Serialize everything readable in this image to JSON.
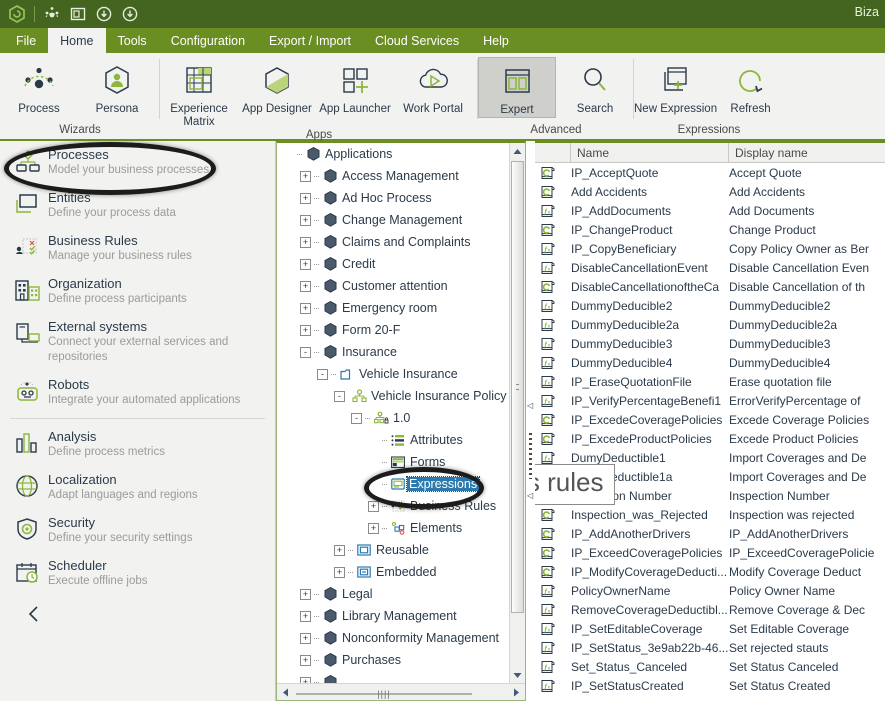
{
  "titlebar": {
    "app_title": "Biza",
    "quick_icons": [
      "logo-icon",
      "process-icon",
      "window-icon",
      "download-icon",
      "upload-icon"
    ]
  },
  "menubar": {
    "items": [
      {
        "label": "File",
        "active": false
      },
      {
        "label": "Home",
        "active": true
      },
      {
        "label": "Tools",
        "active": false
      },
      {
        "label": "Configuration",
        "active": false
      },
      {
        "label": "Export / Import",
        "active": false
      },
      {
        "label": "Cloud Services",
        "active": false
      },
      {
        "label": "Help",
        "active": false
      }
    ]
  },
  "ribbon": {
    "groups": [
      {
        "name": "Wizards",
        "buttons": [
          {
            "label": "Process",
            "icon": "process-network-icon",
            "selected": false
          },
          {
            "label": "Persona",
            "icon": "persona-icon",
            "selected": false
          }
        ]
      },
      {
        "name": "Apps",
        "buttons": [
          {
            "label": "Experience Matrix",
            "icon": "experience-matrix-icon",
            "selected": false
          },
          {
            "label": "App Designer",
            "icon": "app-designer-icon",
            "selected": false
          },
          {
            "label": "App Launcher",
            "icon": "app-launcher-icon",
            "selected": false
          },
          {
            "label": "Work Portal",
            "icon": "work-portal-icon",
            "selected": false
          }
        ]
      },
      {
        "name": "Advanced",
        "buttons": [
          {
            "label": "Expert",
            "icon": "expert-icon",
            "selected": true
          },
          {
            "label": "Search",
            "icon": "search-icon",
            "selected": false
          }
        ]
      },
      {
        "name": "Expressions",
        "buttons": [
          {
            "label": "New Expression",
            "icon": "new-expression-icon",
            "selected": false
          },
          {
            "label": "Refresh",
            "icon": "refresh-icon",
            "selected": false
          }
        ]
      }
    ]
  },
  "sidebar": {
    "items": [
      {
        "title": "Processes",
        "subtitle": "Model your business processes",
        "icon": "processes-icon",
        "highlighted": true
      },
      {
        "title": "Entities",
        "subtitle": "Define your process data",
        "icon": "entities-icon",
        "highlighted": false
      },
      {
        "title": "Business  Rules",
        "subtitle": "Manage your business rules",
        "icon": "rules-icon",
        "highlighted": false
      },
      {
        "title": "Organization",
        "subtitle": "Define process participants",
        "icon": "org-icon",
        "highlighted": false
      },
      {
        "title": "External systems",
        "subtitle": "Connect your external services and repositories",
        "icon": "external-icon",
        "highlighted": false
      },
      {
        "title": "Robots",
        "subtitle": "Integrate your automated applications",
        "icon": "robot-icon",
        "highlighted": false
      }
    ],
    "items2": [
      {
        "title": "Analysis",
        "subtitle": "Define process metrics",
        "icon": "analysis-icon"
      },
      {
        "title": "Localization",
        "subtitle": "Adapt languages and regions",
        "icon": "globe-icon"
      },
      {
        "title": "Security",
        "subtitle": "Define your security settings",
        "icon": "shield-icon"
      },
      {
        "title": "Scheduler",
        "subtitle": "Execute offline jobs",
        "icon": "calendar-clock-icon"
      }
    ],
    "collapse_icon": "chevron-left-icon"
  },
  "tree": {
    "nodes": [
      {
        "label": "Applications",
        "depth": 0,
        "expander": "",
        "icon": "app-hex-icon",
        "selected": false
      },
      {
        "label": "Access Management",
        "depth": 1,
        "expander": "+",
        "icon": "app-hex-icon",
        "selected": false
      },
      {
        "label": "Ad Hoc Process",
        "depth": 1,
        "expander": "+",
        "icon": "app-hex-icon",
        "selected": false
      },
      {
        "label": "Change Management",
        "depth": 1,
        "expander": "+",
        "icon": "app-hex-icon",
        "selected": false
      },
      {
        "label": "Claims and Complaints",
        "depth": 1,
        "expander": "+",
        "icon": "app-hex-icon",
        "selected": false
      },
      {
        "label": "Credit",
        "depth": 1,
        "expander": "+",
        "icon": "app-hex-icon",
        "selected": false
      },
      {
        "label": "Customer attention",
        "depth": 1,
        "expander": "+",
        "icon": "app-hex-icon",
        "selected": false
      },
      {
        "label": "Emergency room",
        "depth": 1,
        "expander": "+",
        "icon": "app-hex-icon",
        "selected": false
      },
      {
        "label": "Form 20-F",
        "depth": 1,
        "expander": "+",
        "icon": "app-hex-icon",
        "selected": false
      },
      {
        "label": "Insurance",
        "depth": 1,
        "expander": "-",
        "icon": "app-hex-icon",
        "selected": false
      },
      {
        "label": "Vehicle Insurance",
        "depth": 2,
        "expander": "-",
        "icon": "folder-icon",
        "selected": false
      },
      {
        "label": "Vehicle Insurance Policy Underwri",
        "depth": 3,
        "expander": "-",
        "icon": "process-tree-icon",
        "selected": false
      },
      {
        "label": "1.0",
        "depth": 4,
        "expander": "-",
        "icon": "version-lock-icon",
        "selected": false
      },
      {
        "label": "Attributes",
        "depth": 5,
        "expander": "",
        "icon": "attributes-icon",
        "selected": false
      },
      {
        "label": "Forms",
        "depth": 5,
        "expander": "",
        "icon": "forms-icon",
        "selected": false
      },
      {
        "label": "Expressions",
        "depth": 5,
        "expander": "",
        "icon": "expressions-icon",
        "selected": true
      },
      {
        "label": "Business Rules",
        "depth": 5,
        "expander": "+",
        "icon": "rules-tree-icon",
        "selected": false
      },
      {
        "label": "Elements",
        "depth": 5,
        "expander": "+",
        "icon": "elements-icon",
        "selected": false
      },
      {
        "label": "Reusable",
        "depth": 3,
        "expander": "+",
        "icon": "reusable-icon",
        "selected": false
      },
      {
        "label": "Embedded",
        "depth": 3,
        "expander": "+",
        "icon": "embedded-icon",
        "selected": false
      },
      {
        "label": "Legal",
        "depth": 1,
        "expander": "+",
        "icon": "app-hex-icon",
        "selected": false
      },
      {
        "label": "Library Management",
        "depth": 1,
        "expander": "+",
        "icon": "app-hex-icon",
        "selected": false
      },
      {
        "label": "Nonconformity Management",
        "depth": 1,
        "expander": "+",
        "icon": "app-hex-icon",
        "selected": false
      },
      {
        "label": "Purchases",
        "depth": 1,
        "expander": "+",
        "icon": "app-hex-icon",
        "selected": false
      }
    ]
  },
  "list": {
    "columns": [
      "",
      "Name",
      "Display name"
    ],
    "rows": [
      {
        "icon": "expression-circular-icon",
        "name": "IP_AcceptQuote",
        "display": "Accept Quote"
      },
      {
        "icon": "expression-circular-icon",
        "name": "Add Accidents",
        "display": "Add Accidents"
      },
      {
        "icon": "expression-script-icon",
        "name": "IP_AddDocuments",
        "display": "Add Documents"
      },
      {
        "icon": "expression-circular-icon",
        "name": "IP_ChangeProduct",
        "display": "Change Product"
      },
      {
        "icon": "expression-script-icon",
        "name": "IP_CopyBeneficiary",
        "display": "Copy Policy Owner as Ber"
      },
      {
        "icon": "expression-script-icon",
        "name": "DisableCancellationEvent",
        "display": "Disable Cancellation Even"
      },
      {
        "icon": "expression-circular-icon",
        "name": "DisableCancellationoftheCa",
        "display": "Disable Cancellation of th"
      },
      {
        "icon": "expression-script-icon",
        "name": "DummyDeducible2",
        "display": "DummyDeducible2"
      },
      {
        "icon": "expression-script-icon",
        "name": "DummyDeducible2a",
        "display": "DummyDeducible2a"
      },
      {
        "icon": "expression-script-icon",
        "name": "DummyDeducible3",
        "display": "DummyDeducible3"
      },
      {
        "icon": "expression-script-icon",
        "name": "DummyDeducible4",
        "display": "DummyDeducible4"
      },
      {
        "icon": "expression-script-icon",
        "name": "IP_EraseQuotationFile",
        "display": "Erase quotation file"
      },
      {
        "icon": "expression-script-icon",
        "name": "IP_VerifyPercentageBenefi1",
        "display": "ErrorVerifyPercentage of"
      },
      {
        "icon": "expression-circular-icon",
        "name": "IP_ExcedeCoveragePolicies",
        "display": "Excede Coverage Policies"
      },
      {
        "icon": "expression-circular-icon",
        "name": "IP_ExcedeProductPolicies",
        "display": "Excede Product Policies"
      },
      {
        "icon": "expression-script-icon",
        "name": "DumyDeductible1",
        "display": "Import Coverages and De"
      },
      {
        "icon": "expression-script-icon",
        "name": "DumyDeductible1a",
        "display": "Import Coverages and De"
      },
      {
        "icon": "expression-script-icon",
        "name": "Inspection Number",
        "display": "Inspection Number"
      },
      {
        "icon": "expression-circular-icon",
        "name": "Inspection_was_Rejected",
        "display": "Inspection was rejected"
      },
      {
        "icon": "expression-circular-icon",
        "name": "IP_AddAnotherDrivers",
        "display": "IP_AddAnotherDrivers"
      },
      {
        "icon": "expression-circular-icon",
        "name": "IP_ExceedCoveragePolicies",
        "display": "IP_ExceedCoveragePolicie"
      },
      {
        "icon": "expression-circular-icon",
        "name": "IP_ModifyCoverageDeducti...",
        "display": "Modify Coverage Deduct"
      },
      {
        "icon": "expression-script-icon",
        "name": "PolicyOwnerName",
        "display": "Policy Owner Name"
      },
      {
        "icon": "expression-script-icon",
        "name": "RemoveCoverageDeductibl...",
        "display": "Remove Coverage & Dec"
      },
      {
        "icon": "expression-script-icon",
        "name": "IP_SetEditableCoverage",
        "display": "Set Editable Coverage"
      },
      {
        "icon": "expression-script-icon",
        "name": "IP_SetStatus_3e9ab22b-46...",
        "display": "Set rejected stauts"
      },
      {
        "icon": "expression-script-icon",
        "name": "Set_Status_Canceled",
        "display": "Set Status Canceled"
      },
      {
        "icon": "expression-script-icon",
        "name": "IP_SetStatusCreated",
        "display": "Set Status Created"
      }
    ]
  },
  "tooltip": {
    "text": "Process rules"
  },
  "colors": {
    "titlebar": "#44651f",
    "menubar": "#6b8e23",
    "accent_green": "#8cb63c",
    "ribbon_bg": "#f2f2f0",
    "dark_navy": "#2b3a4a",
    "selection_blue": "#2a7ab0"
  }
}
